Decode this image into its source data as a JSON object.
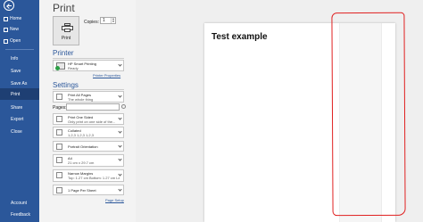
{
  "nav": {
    "items": [
      {
        "label": "Home"
      },
      {
        "label": "New"
      },
      {
        "label": "Open"
      },
      {
        "label": "Info"
      },
      {
        "label": "Save"
      },
      {
        "label": "Save As"
      },
      {
        "label": "Print"
      },
      {
        "label": "Share"
      },
      {
        "label": "Export"
      },
      {
        "label": "Close"
      },
      {
        "label": "Account"
      },
      {
        "label": "Feedback"
      }
    ]
  },
  "print": {
    "title": "Print",
    "button_label": "Print",
    "copies_label": "Copies:",
    "copies_value": "1"
  },
  "printer": {
    "heading": "Printer",
    "name": "HP Smart Printing",
    "status": "Ready",
    "properties_link": "Printer Properties"
  },
  "settings": {
    "heading": "Settings",
    "pages_label": "Pages:",
    "items": [
      {
        "line1": "Print All Pages",
        "line2": "The whole thing"
      },
      {
        "line1": "Print One Sided",
        "line2": "Only print on one side of the..."
      },
      {
        "line1": "Collated",
        "line2": "1,2,3   1,2,3   1,2,3"
      },
      {
        "line1": "Portrait Orientation",
        "line2": ""
      },
      {
        "line1": "A4",
        "line2": "21 cm x 29.7 cm"
      },
      {
        "line1": "Narrow Margins",
        "line2": "Top: 1.27 cm Bottom: 1.27 cm Le..."
      },
      {
        "line1": "1 Page Per Sheet",
        "line2": ""
      }
    ],
    "page_setup_link": "Page Setup"
  },
  "preview": {
    "doc_title": "Test example"
  },
  "colors": {
    "nav_bg": "#2b579a",
    "accent": "#2b579a",
    "annotation": "#e02020"
  }
}
